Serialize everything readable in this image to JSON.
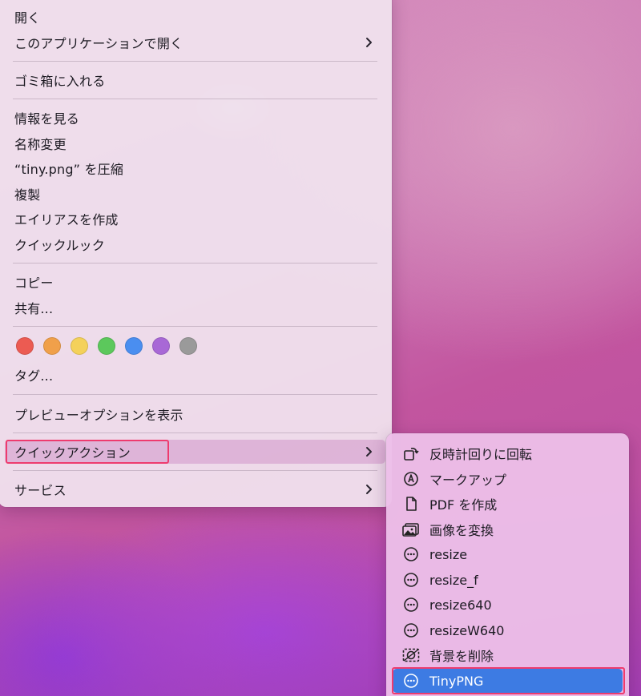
{
  "context_menu": {
    "items": [
      {
        "label": "開く"
      },
      {
        "label": "このアプリケーションで開く"
      },
      {
        "label": "ゴミ箱に入れる"
      },
      {
        "label": "情報を見る"
      },
      {
        "label": "名称変更"
      },
      {
        "label": "“tiny.png” を圧縮"
      },
      {
        "label": "複製"
      },
      {
        "label": "エイリアスを作成"
      },
      {
        "label": "クイックルック"
      },
      {
        "label": "コピー"
      },
      {
        "label": "共有..."
      },
      {
        "label": "タグ..."
      },
      {
        "label": "プレビューオプションを表示"
      },
      {
        "label": "クイックアクション"
      },
      {
        "label": "サービス"
      }
    ],
    "tag_colors": [
      "#ec5b52",
      "#f0a04a",
      "#f4d15a",
      "#5cc85c",
      "#4a8ef0",
      "#a868d6",
      "#9a9a9a"
    ]
  },
  "quick_actions_submenu": {
    "items": [
      {
        "label": "反時計回りに回転",
        "icon": "rotate-left-icon"
      },
      {
        "label": "マークアップ",
        "icon": "markup-icon"
      },
      {
        "label": "PDF を作成",
        "icon": "document-icon"
      },
      {
        "label": "画像を変換",
        "icon": "photos-icon"
      },
      {
        "label": "resize",
        "icon": "ellipsis-circle-icon"
      },
      {
        "label": "resize_f",
        "icon": "ellipsis-circle-icon"
      },
      {
        "label": "resize640",
        "icon": "ellipsis-circle-icon"
      },
      {
        "label": "resizeW640",
        "icon": "ellipsis-circle-icon"
      },
      {
        "label": "背景を削除",
        "icon": "remove-background-icon"
      },
      {
        "label": "TinyPNG",
        "icon": "ellipsis-circle-icon"
      }
    ],
    "selected": "TinyPNG"
  },
  "colors": {
    "highlight_frame": "#ee3b6e",
    "selection": "#3d7be3"
  }
}
